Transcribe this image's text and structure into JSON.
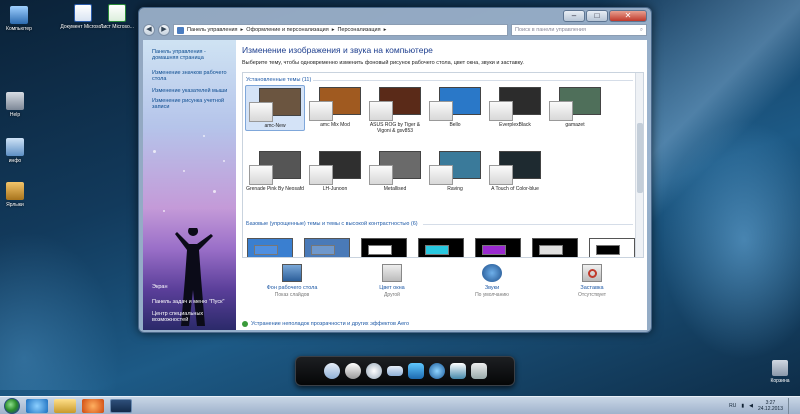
{
  "desktop": {
    "icons": [
      {
        "label": "Компьютер"
      },
      {
        "label": "Документ Microso..."
      },
      {
        "label": "Лист Microso..."
      },
      {
        "label": "Help"
      },
      {
        "label": "инфо"
      },
      {
        "label": "Ярлыки"
      },
      {
        "label": "Корзина"
      }
    ]
  },
  "window": {
    "address": {
      "crumbs": [
        "Панель управления",
        "Оформление и персонализация",
        "Персонализация"
      ],
      "search_placeholder": "Поиск в панели управления"
    },
    "sidebar": {
      "links": [
        "Панель управления - домашняя страница",
        "Изменение значков рабочего стола",
        "Изменение указателей мыши",
        "Изменение рисунка учетной записи"
      ],
      "see_also": [
        "Экран",
        "Панель задач и меню \"Пуск\"",
        "Центр специальных возможностей"
      ]
    },
    "main": {
      "title": "Изменение изображения и звука на компьютере",
      "subtitle": "Выберите тему, чтобы одновременно изменить фоновый рисунок рабочего стола, цвет окна, звуки и заставку.",
      "installed_header": "Установленные темы (11)",
      "themes": [
        {
          "name": "amc-New",
          "bg": "#6b5540",
          "selected": true
        },
        {
          "name": "amc Mix Mod",
          "bg": "#a05a20"
        },
        {
          "name": "ASUS ROG by Tiger & Vigoni & gsv853",
          "bg": "#5a2a18"
        },
        {
          "name": "Bello",
          "bg": "#2a78c8"
        },
        {
          "name": "EverplexBlack",
          "bg": "#2c2c2c"
        },
        {
          "name": "gamazet",
          "bg": "#4f6f5a"
        },
        {
          "name": "Grenade Pink By Neosafd",
          "bg": "#555555"
        },
        {
          "name": "LH-Junoon",
          "bg": "#2f2f2f"
        },
        {
          "name": "Metallised",
          "bg": "#6a6a6a"
        },
        {
          "name": "Raving",
          "bg": "#3a7a9a"
        },
        {
          "name": "A Touch of Color-blue",
          "bg": "#1e2a30"
        }
      ],
      "basic_header": "Базовые (упрощенные) темы и темы с высокой контрастностью (6)",
      "basic_themes": [
        {
          "bg": "#3a7fd0",
          "bar": "#4f8fe0"
        },
        {
          "bg": "#4a7ab8",
          "bar": "#6f98cc"
        },
        {
          "bg": "#000000",
          "bar": "#ffffff"
        },
        {
          "bg": "#000000",
          "bar": "#28c8e0"
        },
        {
          "bg": "#000000",
          "bar": "#9a2ad0"
        },
        {
          "bg": "#000000",
          "bar": "#e0e0e0"
        },
        {
          "bg": "#ffffff",
          "bar": "#000000"
        }
      ],
      "bottom": [
        {
          "label": "Фон рабочего стола",
          "sub": "Показ слайдов",
          "icon": "desktop-background-icon"
        },
        {
          "label": "Цвет окна",
          "sub": "Другой",
          "icon": "window-color-icon"
        },
        {
          "label": "Звуки",
          "sub": "По умолчанию",
          "icon": "sounds-icon"
        },
        {
          "label": "Заставка",
          "sub": "Отсутствует",
          "icon": "screensaver-icon"
        }
      ],
      "troubleshoot": "Устранение неполадок прозрачности и других эффектов Aero"
    }
  },
  "taskbar": {
    "lang": "RU",
    "time": "3:27",
    "date": "24.12.2013"
  },
  "colors": {
    "accent": "#1e3f8f",
    "link": "#1b57a5"
  }
}
